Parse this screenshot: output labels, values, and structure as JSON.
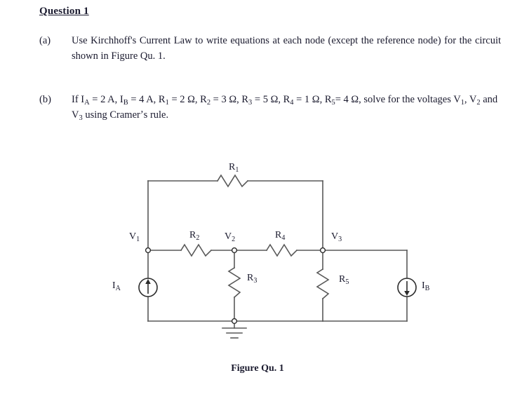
{
  "document": {
    "heading": "Question 1",
    "figure_caption": "Figure Qu. 1"
  },
  "parts": [
    {
      "label": "(a)",
      "text": "Use Kirchhoff's Current Law to write equations at each node (except the reference node) for the circuit shown in Figure Qu. 1."
    },
    {
      "label": "(b)",
      "text_html": "If Iᴀ = 2 A, Iʙ = 4 A, R₁ = 2 Ω, R₂ = 3 Ω, R₃ = 5 Ω, R₄ = 1 Ω, R₅= 4 Ω, solve for the voltages V₁, V₂ and V₃ using Cramer's rule."
    }
  ],
  "circuit": {
    "labels": {
      "r1": "R1",
      "r2": "R2",
      "r3": "R3",
      "r4": "R4",
      "r5": "R5",
      "v1": "V1",
      "v2": "V2",
      "v3": "V3",
      "ia": "IA",
      "ib": "IB"
    },
    "given_values": {
      "IA": "2 A",
      "IB": "4 A",
      "R1": "2 Ω",
      "R2": "3 Ω",
      "R3": "5 Ω",
      "R4": "1 Ω",
      "R5": "4 Ω"
    },
    "unknowns": [
      "V1",
      "V2",
      "V3"
    ],
    "colors": {
      "wire": "#585858",
      "text": "#1a1a2e",
      "background": "#ffffff"
    }
  }
}
